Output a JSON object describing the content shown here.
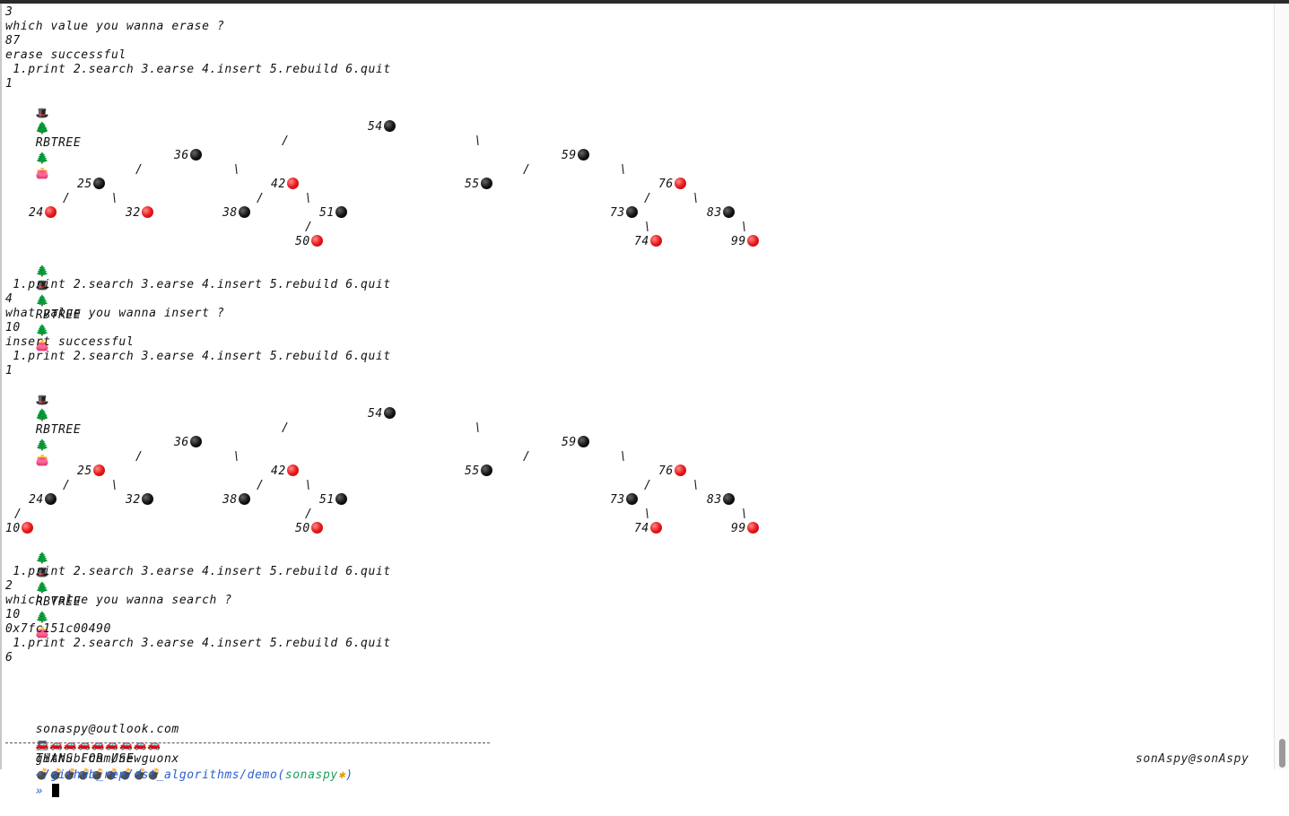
{
  "menu": " 1.print 2.search 3.earse 4.insert 5.rebuild 6.quit",
  "header": {
    "hat_icon": "🎩",
    "tree_icon": "🌲",
    "title": "RBTREE",
    "mitten_icon": "👛"
  },
  "lines": [
    "3",
    "which value you wanna erase ?",
    "87",
    "erase successful",
    " 1.print 2.search 3.earse 4.insert 5.rebuild 6.quit",
    "1",
    " 1.print 2.search 3.earse 4.insert 5.rebuild 6.quit",
    "4",
    "what value you wanna insert ?",
    "10",
    "insert successful",
    " 1.print 2.search 3.earse 4.insert 5.rebuild 6.quit",
    "1",
    " 1.print 2.search 3.earse 4.insert 5.rebuild 6.quit",
    "2",
    "which value you wanna search ?",
    "10",
    "0x7fc151c00490",
    " 1.print 2.search 3.earse 4.insert 5.rebuild 6.quit",
    "6"
  ],
  "tree1": {
    "nodes": [
      {
        "v": "54",
        "color": "black"
      },
      {
        "v": "36",
        "color": "black"
      },
      {
        "v": "59",
        "color": "black"
      },
      {
        "v": "25",
        "color": "black"
      },
      {
        "v": "42",
        "color": "red"
      },
      {
        "v": "55",
        "color": "black"
      },
      {
        "v": "76",
        "color": "red"
      },
      {
        "v": "24",
        "color": "red"
      },
      {
        "v": "32",
        "color": "red"
      },
      {
        "v": "38",
        "color": "black"
      },
      {
        "v": "51",
        "color": "black"
      },
      {
        "v": "73",
        "color": "black"
      },
      {
        "v": "83",
        "color": "black"
      },
      {
        "v": "50",
        "color": "red"
      },
      {
        "v": "74",
        "color": "red"
      },
      {
        "v": "99",
        "color": "red"
      }
    ]
  },
  "tree2": {
    "nodes": [
      {
        "v": "54",
        "color": "black"
      },
      {
        "v": "36",
        "color": "black"
      },
      {
        "v": "59",
        "color": "black"
      },
      {
        "v": "25",
        "color": "red"
      },
      {
        "v": "42",
        "color": "red"
      },
      {
        "v": "55",
        "color": "black"
      },
      {
        "v": "76",
        "color": "red"
      },
      {
        "v": "24",
        "color": "black"
      },
      {
        "v": "32",
        "color": "black"
      },
      {
        "v": "38",
        "color": "black"
      },
      {
        "v": "51",
        "color": "black"
      },
      {
        "v": "73",
        "color": "black"
      },
      {
        "v": "83",
        "color": "black"
      },
      {
        "v": "10",
        "color": "red"
      },
      {
        "v": "50",
        "color": "red"
      },
      {
        "v": "74",
        "color": "red"
      },
      {
        "v": "99",
        "color": "red"
      }
    ]
  },
  "footer": {
    "email": "sonaspy@outlook.com",
    "laptop_icon": "💻",
    "github": "github.com/newguonx",
    "cars": "🚗🚗🚗🚗🚗🚗🚗🚗🚗",
    "thanks": "THANS FOR USE",
    "bombs": "💣💣💣💣💣💣💣💣💣"
  },
  "prompt": {
    "path": "~/github_rep/dst_algorithms/demo",
    "branch": "sonaspy",
    "dirty": "✱",
    "arrow": "»",
    "right": "sonAspy@sonAspy"
  },
  "colors": {
    "black_node": "#000000",
    "red_node": "#e8191c",
    "path": "#2a5fd1",
    "branch": "#1e9e5a"
  }
}
